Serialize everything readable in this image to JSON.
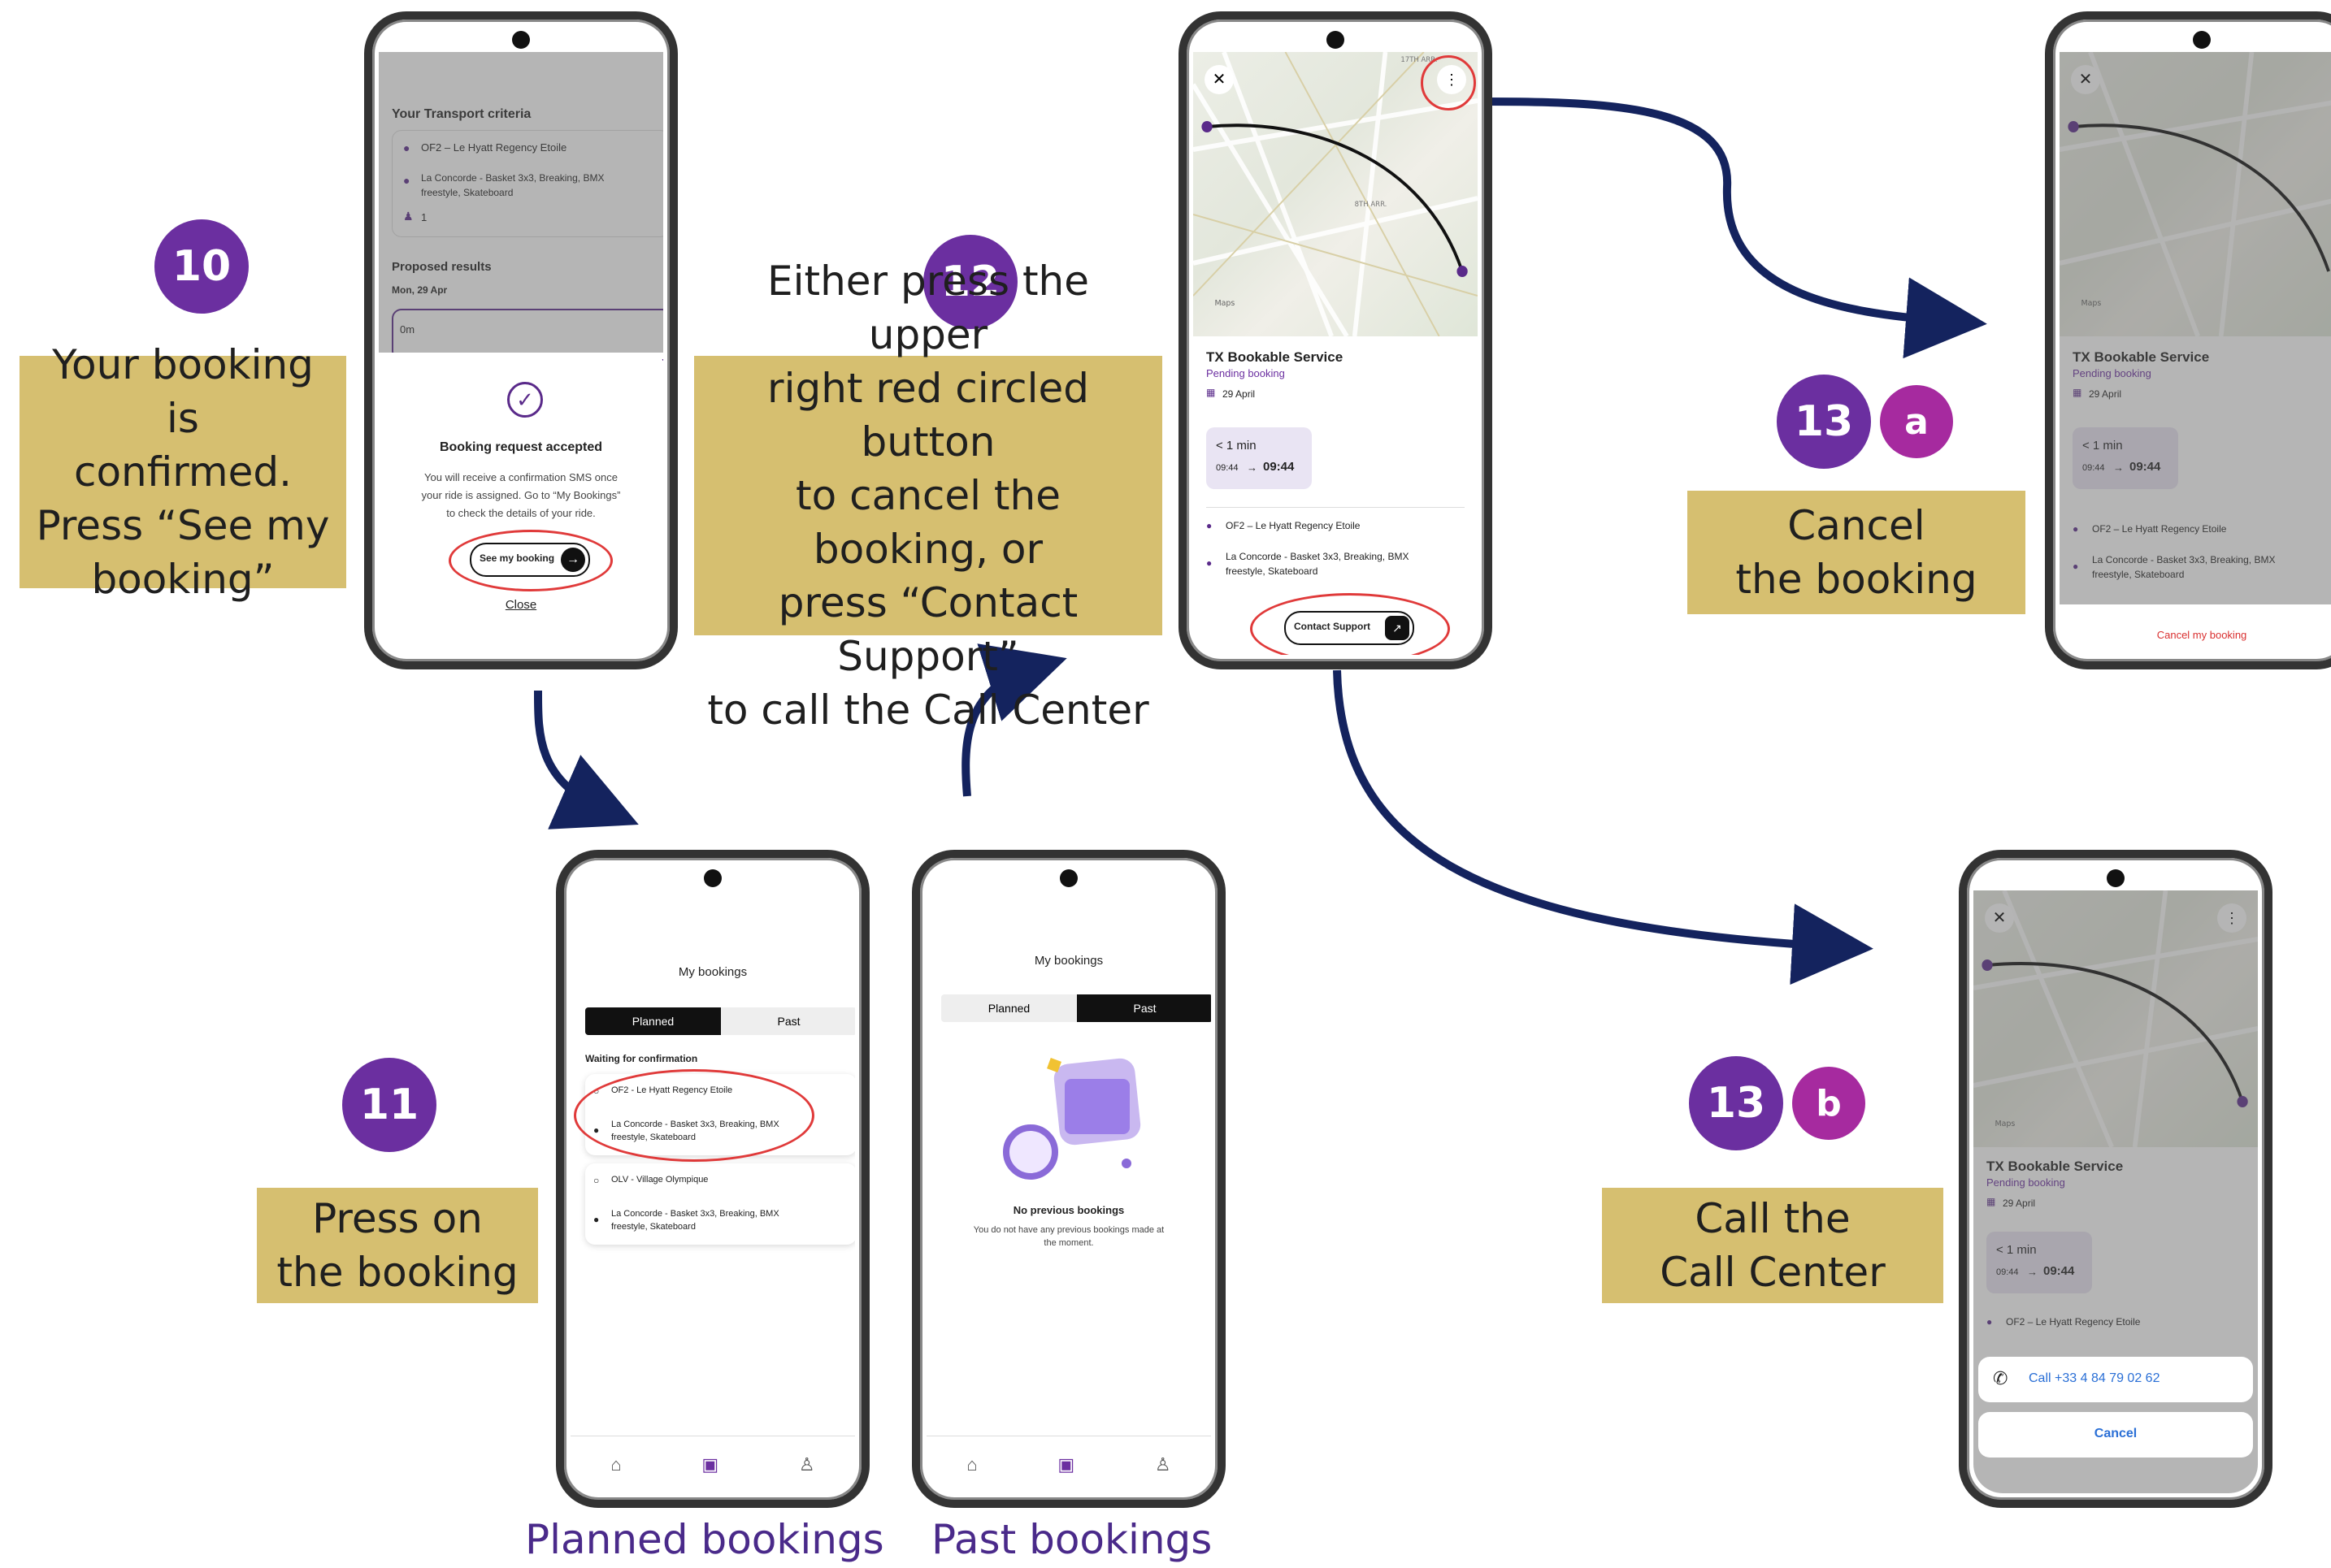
{
  "steps": {
    "s10": {
      "num": "10",
      "lines": [
        "Your booking is",
        "confirmed.",
        "Press “See my",
        "booking”"
      ]
    },
    "s11": {
      "num": "11",
      "lines": [
        "Press on",
        "the booking"
      ]
    },
    "s12": {
      "num": "12",
      "lines": [
        "Either press the upper",
        "right red circled button",
        "to cancel the booking, or",
        "press “Contact Support”",
        "to call the Call Center"
      ]
    },
    "s13a": {
      "num": "13",
      "letter": "a",
      "lines": [
        "Cancel",
        "the booking"
      ]
    },
    "s13b": {
      "num": "13",
      "letter": "b",
      "lines": [
        "Call the",
        "Call Center"
      ]
    }
  },
  "bottom_labels": {
    "planned": "Planned bookings",
    "past": "Past bookings"
  },
  "phone1": {
    "criteria_title": "Your Transport criteria",
    "origin": "OF2 – Le Hyatt Regency Etoile",
    "destination_l1": "La Concorde - Basket 3x3, Breaking, BMX",
    "destination_l2": "freestyle, Skateboard",
    "passengers": "1",
    "results_title": "Proposed results",
    "date": "Mon, 29 Apr",
    "duration": "0m",
    "modal_title": "Booking request accepted",
    "modal_l1": "You will receive a confirmation SMS once",
    "modal_l2": "your ride is assigned. Go to “My Bookings”",
    "modal_l3": "to check the details of your ride.",
    "see_button": "See my booking",
    "close_link": "Close"
  },
  "phone_planned": {
    "title": "My bookings",
    "tab_planned": "Planned",
    "tab_past": "Past",
    "section": "Waiting for confirmation",
    "card1_origin": "OF2 - Le Hyatt Regency Etoile",
    "card1_dest_l1": "La Concorde - Basket 3x3, Breaking, BMX",
    "card1_dest_l2": "freestyle, Skateboard",
    "card2_origin": "OLV - Village Olympique",
    "card2_dest_l1": "La Concorde - Basket 3x3, Breaking, BMX",
    "card2_dest_l2": "freestyle, Skateboard"
  },
  "phone_past": {
    "title": "My bookings",
    "tab_planned": "Planned",
    "tab_past": "Past",
    "empty_title": "No previous bookings",
    "empty_l1": "You do not have any previous bookings made at",
    "empty_l2": "the moment."
  },
  "phone_detail": {
    "service": "TX Bookable Service",
    "status": "Pending booking",
    "date": "29 April",
    "duration": "< 1 min",
    "time_from": "09:44",
    "time_to": "09:44",
    "origin": "OF2 – Le Hyatt Regency Etoile",
    "dest_l1": "La Concorde - Basket 3x3, Breaking, BMX",
    "dest_l2": "freestyle, Skateboard",
    "contact_button": "Contact Support",
    "map_label": "Maps",
    "arr_top": "17TH ARR.",
    "arr_mid": "8TH ARR."
  },
  "phone_cancel": {
    "service": "TX Bookable Service",
    "status": "Pending booking",
    "date": "29 April",
    "duration": "< 1 min",
    "time_from": "09:44",
    "time_to": "09:44",
    "origin": "OF2 – Le Hyatt Regency Etoile",
    "dest_l1": "La Concorde - Basket 3x3, Breaking, BMX",
    "dest_l2": "freestyle, Skateboard",
    "cancel_link": "Cancel my booking"
  },
  "phone_call": {
    "service": "TX Bookable Service",
    "status": "Pending booking",
    "date": "29 April",
    "duration": "< 1 min",
    "time_from": "09:44",
    "time_to": "09:44",
    "origin": "OF2 – Le Hyatt Regency Etoile",
    "call": "Call +33 4 84 79 02 62",
    "cancel": "Cancel"
  },
  "colors": {
    "badge": "#6b2fa0",
    "badge_letter": "#a62a9f",
    "caption_bg": "#d6bf70",
    "arrow": "#14235e",
    "highlight": "#e03a3a",
    "label": "#4a2a8a"
  }
}
